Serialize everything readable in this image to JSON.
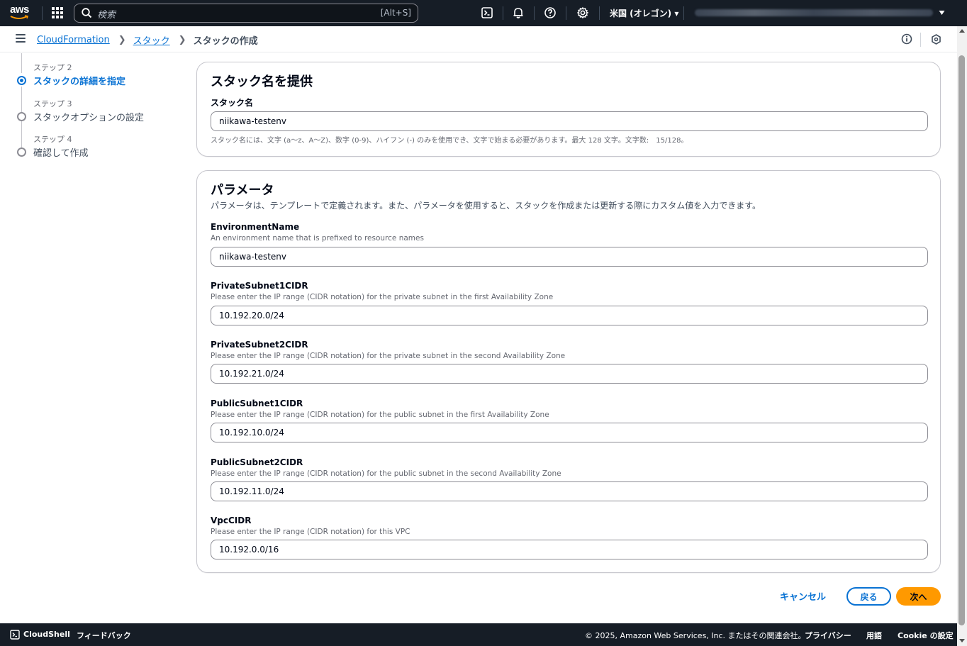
{
  "nav": {
    "logo_text": "aws",
    "search_placeholder": "検索",
    "search_shortcut": "[Alt+S]",
    "region": "米国 (オレゴン) ▾",
    "icons": [
      "apps-grid-icon",
      "search-icon",
      "cloudshell-icon",
      "bell-icon",
      "help-icon",
      "gear-icon",
      "caret-down-icon"
    ]
  },
  "breadcrumb": {
    "items": [
      "CloudFormation",
      "スタック",
      "スタックの作成"
    ]
  },
  "steps": [
    {
      "label": "ステップ 2",
      "title": "スタックの詳細を指定",
      "active": true
    },
    {
      "label": "ステップ 3",
      "title": "スタックオプションの設定",
      "active": false
    },
    {
      "label": "ステップ 4",
      "title": "確認して作成",
      "active": false
    }
  ],
  "stack_name_panel": {
    "heading": "スタック名を提供",
    "field_label": "スタック名",
    "value": "niikawa-testenv",
    "constraint": "スタック名には、文字 (a〜z、A〜Z)、数字 (0-9)、ハイフン (-) のみを使用でき、文字で始まる必要があります。最大 128 文字。文字数:　15/128。"
  },
  "parameters_panel": {
    "heading": "パラメータ",
    "description": "パラメータは、テンプレートで定義されます。また、パラメータを使用すると、スタックを作成または更新する際にカスタム値を入力できます。",
    "params": [
      {
        "name": "EnvironmentName",
        "desc": "An environment name that is prefixed to resource names",
        "value": "niikawa-testenv"
      },
      {
        "name": "PrivateSubnet1CIDR",
        "desc": "Please enter the IP range (CIDR notation) for the private subnet in the first Availability Zone",
        "value": "10.192.20.0/24"
      },
      {
        "name": "PrivateSubnet2CIDR",
        "desc": "Please enter the IP range (CIDR notation) for the private subnet in the second Availability Zone",
        "value": "10.192.21.0/24"
      },
      {
        "name": "PublicSubnet1CIDR",
        "desc": "Please enter the IP range (CIDR notation) for the public subnet in the first Availability Zone",
        "value": "10.192.10.0/24"
      },
      {
        "name": "PublicSubnet2CIDR",
        "desc": "Please enter the IP range (CIDR notation) for the public subnet in the second Availability Zone",
        "value": "10.192.11.0/24"
      },
      {
        "name": "VpcCIDR",
        "desc": "Please enter the IP range (CIDR notation) for this VPC",
        "value": "10.192.0.0/16"
      }
    ]
  },
  "actions": {
    "cancel": "キャンセル",
    "back": "戻る",
    "next": "次へ"
  },
  "footer": {
    "cloudshell": "CloudShell",
    "feedback": "フィードバック",
    "copyright": "© 2025, Amazon Web Services, Inc. またはその関連会社。",
    "privacy": "プライバシー",
    "terms": "用語",
    "cookie": "Cookie の設定"
  },
  "colors": {
    "nav_bg": "#161d26",
    "link": "#0972d3",
    "primary_button": "#ff9900",
    "border": "#c6c6cd"
  }
}
